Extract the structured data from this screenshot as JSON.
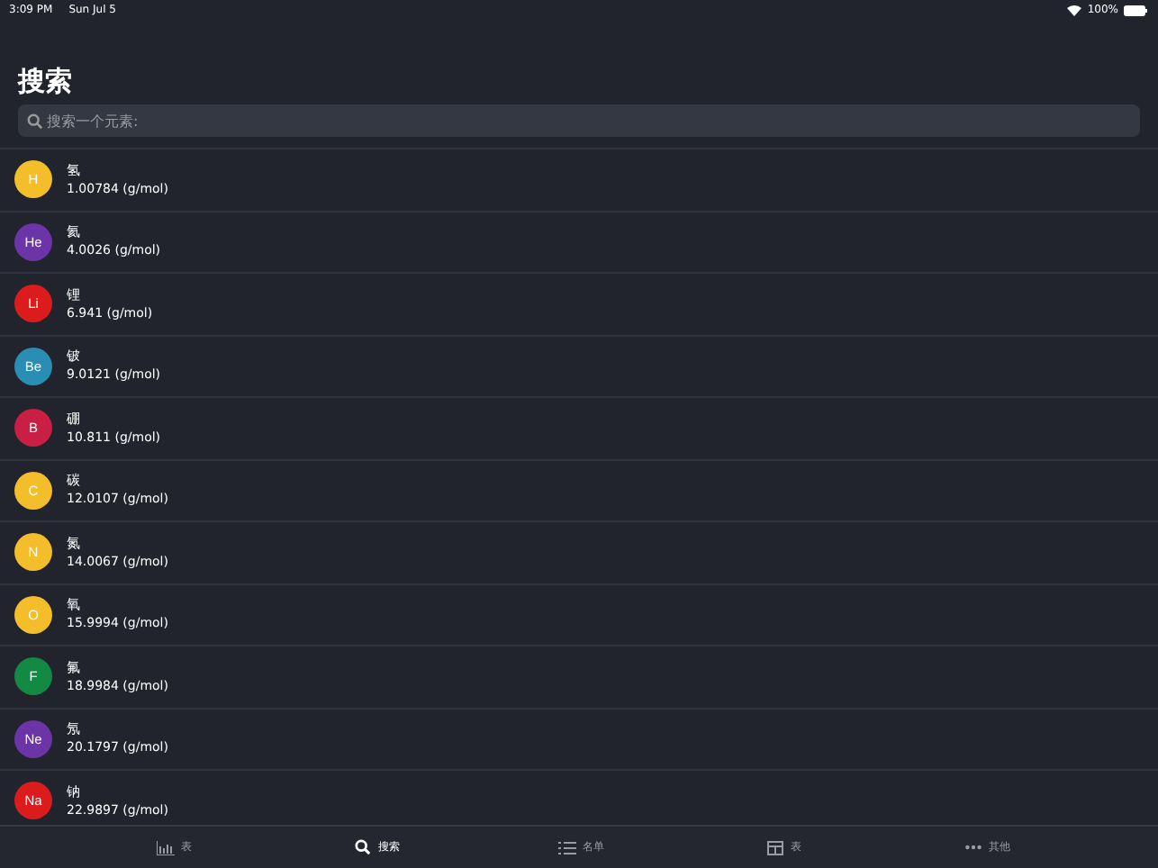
{
  "status_bar": {
    "time": "3:09 PM",
    "date": "Sun Jul 5",
    "battery": "100%"
  },
  "title": "搜索",
  "search": {
    "placeholder": "搜索一个元素:"
  },
  "elements": [
    {
      "symbol": "H",
      "name": "氢",
      "mass": "1.00784 (g/mol)",
      "color": "#f4bd2a"
    },
    {
      "symbol": "He",
      "name": "氦",
      "mass": "4.0026 (g/mol)",
      "color": "#6b35a8"
    },
    {
      "symbol": "Li",
      "name": "锂",
      "mass": "6.941 (g/mol)",
      "color": "#dc1c1c"
    },
    {
      "symbol": "Be",
      "name": "铍",
      "mass": "9.0121 (g/mol)",
      "color": "#2a8db3"
    },
    {
      "symbol": "B",
      "name": "硼",
      "mass": "10.811 (g/mol)",
      "color": "#c91f45"
    },
    {
      "symbol": "C",
      "name": "碳",
      "mass": "12.0107 (g/mol)",
      "color": "#f4bd2a"
    },
    {
      "symbol": "N",
      "name": "氮",
      "mass": "14.0067 (g/mol)",
      "color": "#f4bd2a"
    },
    {
      "symbol": "O",
      "name": "氧",
      "mass": "15.9994 (g/mol)",
      "color": "#f4bd2a"
    },
    {
      "symbol": "F",
      "name": "氟",
      "mass": "18.9984 (g/mol)",
      "color": "#128a44"
    },
    {
      "symbol": "Ne",
      "name": "氖",
      "mass": "20.1797 (g/mol)",
      "color": "#6b35a8"
    },
    {
      "symbol": "Na",
      "name": "钠",
      "mass": "22.9897 (g/mol)",
      "color": "#dc1c1c"
    }
  ],
  "tabs": [
    {
      "label": "表",
      "kind": "chart",
      "selected": false
    },
    {
      "label": "搜索",
      "kind": "search",
      "selected": true
    },
    {
      "label": "名单",
      "kind": "list",
      "selected": false
    },
    {
      "label": "表",
      "kind": "table",
      "selected": false
    },
    {
      "label": "其他",
      "kind": "more",
      "selected": false
    }
  ]
}
